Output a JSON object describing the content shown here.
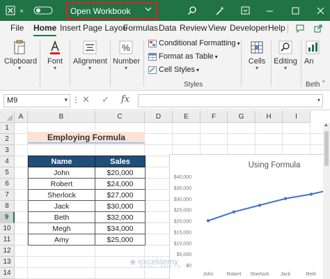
{
  "titlebar": {
    "workbook_title": "Open Workbook",
    "icons": [
      "excel-logo-icon",
      "search-icon",
      "magic-wand-icon",
      "ribbon-display-icon",
      "minimize-icon",
      "restore-icon",
      "close-icon"
    ]
  },
  "tabs": [
    "File",
    "Home",
    "Insert",
    "Page Layout",
    "Formulas",
    "Data",
    "Review",
    "View",
    "Developer",
    "Help"
  ],
  "tabs_display": [
    "File",
    "Home",
    "Insert",
    "Page Layou",
    "Formulas",
    "Data",
    "Review",
    "View",
    "Developer",
    "Help"
  ],
  "active_tab": "Home",
  "ribbon": {
    "clipboard": "Clipboard",
    "font": "Font",
    "alignment": "Alignment",
    "number": "Number",
    "conditional_formatting": "Conditional Formatting",
    "format_as_table": "Format as Table",
    "cell_styles": "Cell Styles",
    "styles_group": "Styles",
    "cells": "Cells",
    "editing": "Editing",
    "analyze_data": "An",
    "analyze_caption": "Beth"
  },
  "formula_bar": {
    "name_box": "M9",
    "cancel_glyph": "✕",
    "enter_glyph": "✓",
    "fx_label": "fx",
    "formula": ""
  },
  "columns": [
    "A",
    "B",
    "C",
    "D",
    "E",
    "F",
    "G",
    "H",
    "I"
  ],
  "rows": [
    "1",
    "2",
    "3",
    "4",
    "5",
    "6",
    "7",
    "8",
    "9",
    "10",
    "11",
    "12",
    "13",
    "14"
  ],
  "selected_row": "9",
  "sheet": {
    "title": "Employing Formula",
    "headers": [
      "Name",
      "Sales"
    ],
    "rows": [
      [
        "John",
        "$20,000"
      ],
      [
        "Robert",
        "$24,000"
      ],
      [
        "Sherlock",
        "$27,000"
      ],
      [
        "Jack",
        "$30,000"
      ],
      [
        "Beth",
        "$32,000"
      ],
      [
        "Megh",
        "$34,000"
      ],
      [
        "Amy",
        "$25,000"
      ]
    ]
  },
  "chart_data": {
    "type": "line",
    "title": "Using Formula",
    "categories": [
      "John",
      "Robert",
      "Sherlock",
      "Jack",
      "Beth"
    ],
    "series": [
      {
        "values": [
          20000,
          24000,
          27000,
          30000,
          32000
        ]
      }
    ],
    "y_ticks": [
      "$0",
      "$5,000",
      "$10,000",
      "$15,000",
      "$20,000",
      "$25,000",
      "$30,000",
      "$35,000",
      "$40,000"
    ],
    "ylim": [
      0,
      40000
    ],
    "grid": false,
    "line_color": "#4472c4"
  },
  "watermark": {
    "brand": "exceldemy",
    "tagline": "EXCEL · DATA · BI"
  },
  "colors": {
    "excel_green": "#217346",
    "header_fill": "#1f4e79",
    "title_fill": "#fbe3d6",
    "highlight_border": "#dd2222"
  }
}
